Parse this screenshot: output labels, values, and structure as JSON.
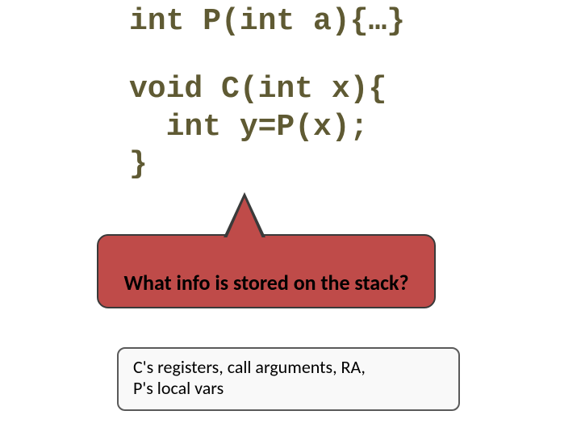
{
  "code": {
    "l1": "int P(int a){…}",
    "l3": "void C(int x){",
    "l4": "  int y=P(x);",
    "l5": "}"
  },
  "bubble": {
    "question": "What info is stored on the stack?",
    "fill": "#bf4b49",
    "border": "#3a3a3a"
  },
  "answer": {
    "line1": "C's registers, call arguments, RA,",
    "line2": "P's local vars"
  }
}
